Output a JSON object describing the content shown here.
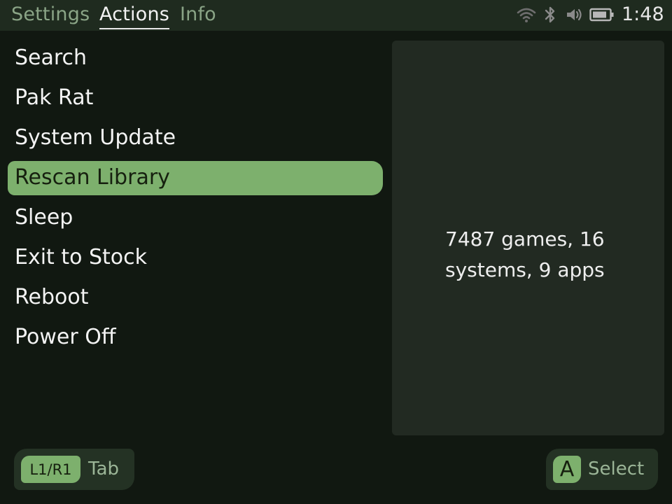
{
  "tabs": [
    {
      "label": "Settings",
      "active": false
    },
    {
      "label": "Actions",
      "active": true
    },
    {
      "label": "Info",
      "active": false
    }
  ],
  "status": {
    "icons": [
      "wifi-icon",
      "bluetooth-icon",
      "volume-icon",
      "battery-icon"
    ],
    "time": "1:48"
  },
  "menu": {
    "items": [
      {
        "label": "Search"
      },
      {
        "label": "Pak Rat"
      },
      {
        "label": "System Update"
      },
      {
        "label": "Rescan Library",
        "selected": true
      },
      {
        "label": "Sleep"
      },
      {
        "label": "Exit to Stock"
      },
      {
        "label": "Reboot"
      },
      {
        "label": "Power Off"
      }
    ]
  },
  "info_panel": {
    "text": "7487 games, 16 systems, 9 apps"
  },
  "hints": {
    "tab": {
      "key": "L1/R1",
      "label": "Tab"
    },
    "select": {
      "key": "A",
      "label": "Select"
    }
  },
  "colors": {
    "background": "#111811",
    "topbar": "#1f2b1f",
    "accent": "#7db06d",
    "panel": "#222a22",
    "inactive_tab": "#8aa486"
  }
}
